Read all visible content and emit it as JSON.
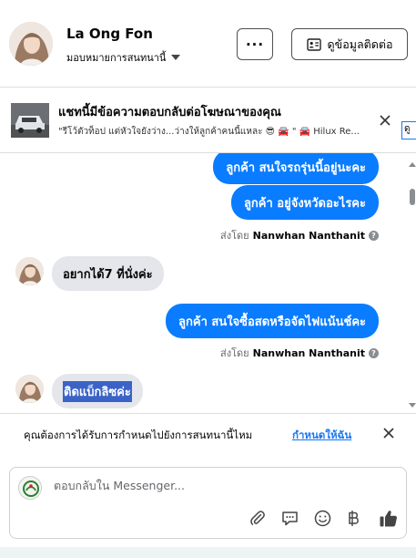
{
  "header": {
    "name": "La Ong Fon",
    "assign_label": "มอบหมายการสนทนานี้",
    "more_label": "···",
    "contact_button": "ดูข้อมูลติดต่อ"
  },
  "ad_banner": {
    "title": "แชทนี้มีข้อความตอบกลับต่อโฆษณาของคุณ",
    "subtitle": "\"รีโว้ตัวท็อป แต่หัวใจยังว่าง...ว่างให้ลูกค้าคนนี้แหละ 😎 🚘 \" 🚘 Hilux Re...",
    "cut_text": "ดู"
  },
  "messages": [
    {
      "type": "out",
      "text": "ลูกค้า สนใจรถรุ่นนี้อยู่นะคะ"
    },
    {
      "type": "out",
      "text": "ลูกค้า อยู่จังหวัดอะไรคะ"
    },
    {
      "type": "sent_by",
      "prefix": "ส่งโดย",
      "name": "Nanwhan Nanthanit"
    },
    {
      "type": "in",
      "text": "อยากได้7 ที่นั่งค่ะ"
    },
    {
      "type": "out",
      "text": "ลูกค้า สนใจซื้อสดหรือจัดไฟแน้นช์คะ"
    },
    {
      "type": "sent_by",
      "prefix": "ส่งโดย",
      "name": "Nanwhan Nanthanit"
    },
    {
      "type": "in",
      "text": "ติดแบ็กลิซค่ะ"
    }
  ],
  "reminder": {
    "text": "คุณต้องการได้รับการกำหนดไปยังการสนทนานี้ไหม",
    "link": "กำหนดให้ฉัน"
  },
  "composer": {
    "placeholder": "ตอบกลับใน Messenger..."
  },
  "colors": {
    "accent": "#0a7cff",
    "incoming_bubble": "#e4e6eb",
    "link": "#1877f2",
    "selection": "#3b63c7"
  },
  "icons": {
    "more": "more-icon",
    "contact_card": "contact-card-icon",
    "close": "close-icon",
    "info": "info-icon",
    "attach": "paperclip-icon",
    "saved_reply": "chat-bubble-icon",
    "emoji": "emoji-icon",
    "currency": "baht-icon",
    "like": "thumbs-up-icon"
  }
}
